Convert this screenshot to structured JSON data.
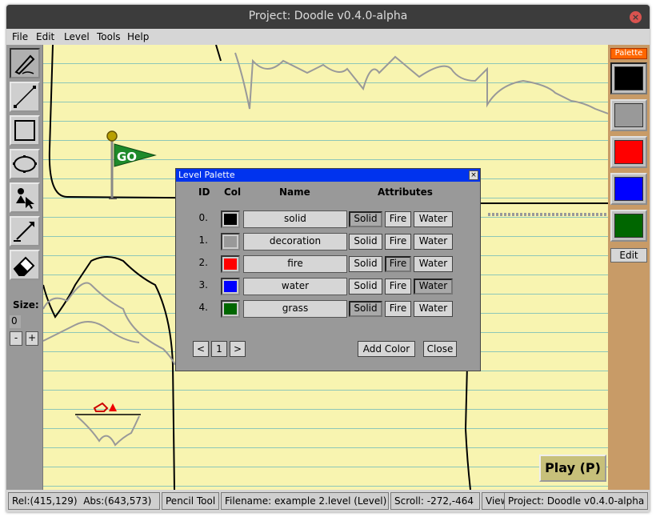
{
  "window": {
    "title": "Project: Doodle v0.4.0-alpha"
  },
  "menu": {
    "file": "File",
    "edit": "Edit",
    "level": "Level",
    "tools": "Tools",
    "help": "Help"
  },
  "toolbar": {
    "tools": [
      "pencil-tool",
      "line-tool",
      "rectangle-tool",
      "ellipse-tool",
      "actor-tool",
      "link-tool",
      "eraser-tool"
    ],
    "size_label": "Size:",
    "size_value": "0",
    "minus": "-",
    "plus": "+"
  },
  "canvas": {
    "flag_text": "GO",
    "play_button": "Play (P)"
  },
  "palette_panel": {
    "title": "Palette",
    "swatches": [
      "#000000",
      "#999999",
      "#ff0000",
      "#0000ff",
      "#006600"
    ],
    "edit_button": "Edit"
  },
  "level_palette": {
    "title": "Level Palette",
    "close_glyph": "×",
    "headers": {
      "id": "ID",
      "col": "Col",
      "name": "Name",
      "attributes": "Attributes"
    },
    "attr_labels": {
      "solid": "Solid",
      "fire": "Fire",
      "water": "Water"
    },
    "rows": [
      {
        "id": "0.",
        "color": "#000000",
        "name": "solid",
        "solid": true,
        "fire": false,
        "water": false
      },
      {
        "id": "1.",
        "color": "#999999",
        "name": "decoration",
        "solid": false,
        "fire": false,
        "water": false
      },
      {
        "id": "2.",
        "color": "#ff0000",
        "name": "fire",
        "solid": false,
        "fire": true,
        "water": false
      },
      {
        "id": "3.",
        "color": "#0000ff",
        "name": "water",
        "solid": false,
        "fire": false,
        "water": true
      },
      {
        "id": "4.",
        "color": "#006600",
        "name": "grass",
        "solid": true,
        "fire": false,
        "water": false
      }
    ],
    "pager": {
      "prev": "<",
      "page": "1",
      "next": ">"
    },
    "add_color": "Add Color",
    "close": "Close"
  },
  "statusbar": {
    "rel": "Rel:(415,129)",
    "abs": "Abs:(643,573)",
    "tool": "Pencil Tool",
    "filename": "Filename: example 2.level (Level)",
    "scroll": "Scroll: -272,-464",
    "view": "View",
    "project": "Project: Doodle v0.4.0-alpha"
  }
}
